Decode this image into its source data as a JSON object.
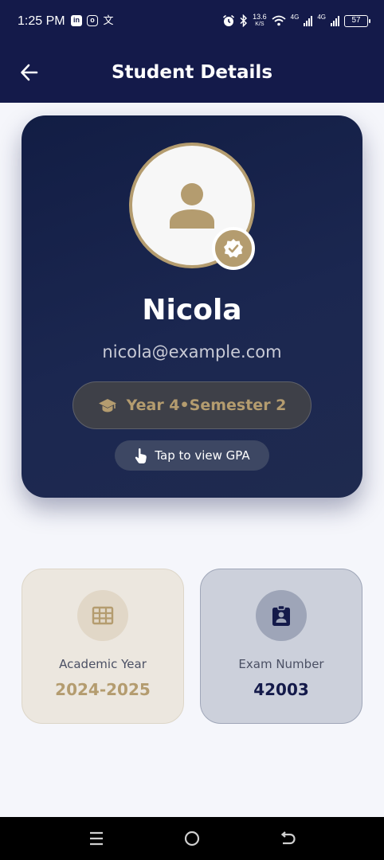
{
  "status_bar": {
    "time": "1:25 PM",
    "speed_value": "13.6",
    "speed_unit": "K/S",
    "network_1": "4G",
    "network_2": "4G",
    "battery": "57",
    "left_icons": [
      "linkedin-icon",
      "instagram-icon",
      "app-glyph-icon"
    ],
    "right_icons": [
      "alarm-icon",
      "bluetooth-icon",
      "wifi-icon",
      "signal-icon",
      "signal-icon",
      "battery-icon"
    ]
  },
  "header": {
    "title": "Student Details",
    "back_icon": "arrow-left-icon"
  },
  "profile": {
    "name": "Nicola",
    "email": "nicola@example.com",
    "year_semester": "Year 4•Semester 2",
    "year_icon": "graduation-cap-icon",
    "gpa_button": "Tap to view GPA",
    "gpa_icon": "tap-hand-icon",
    "avatar_icon": "person-icon",
    "badge_icon": "verified-check-icon"
  },
  "info_cards": [
    {
      "label": "Academic Year",
      "value": "2024-2025",
      "icon": "calendar-grid-icon"
    },
    {
      "label": "Exam Number",
      "value": "42003",
      "icon": "id-badge-icon"
    }
  ],
  "nav_bar": [
    "menu-icon",
    "home-icon",
    "back-icon"
  ],
  "colors": {
    "primary": "#141a4a",
    "gold": "#b49c6f",
    "background": "#f5f6fb"
  }
}
